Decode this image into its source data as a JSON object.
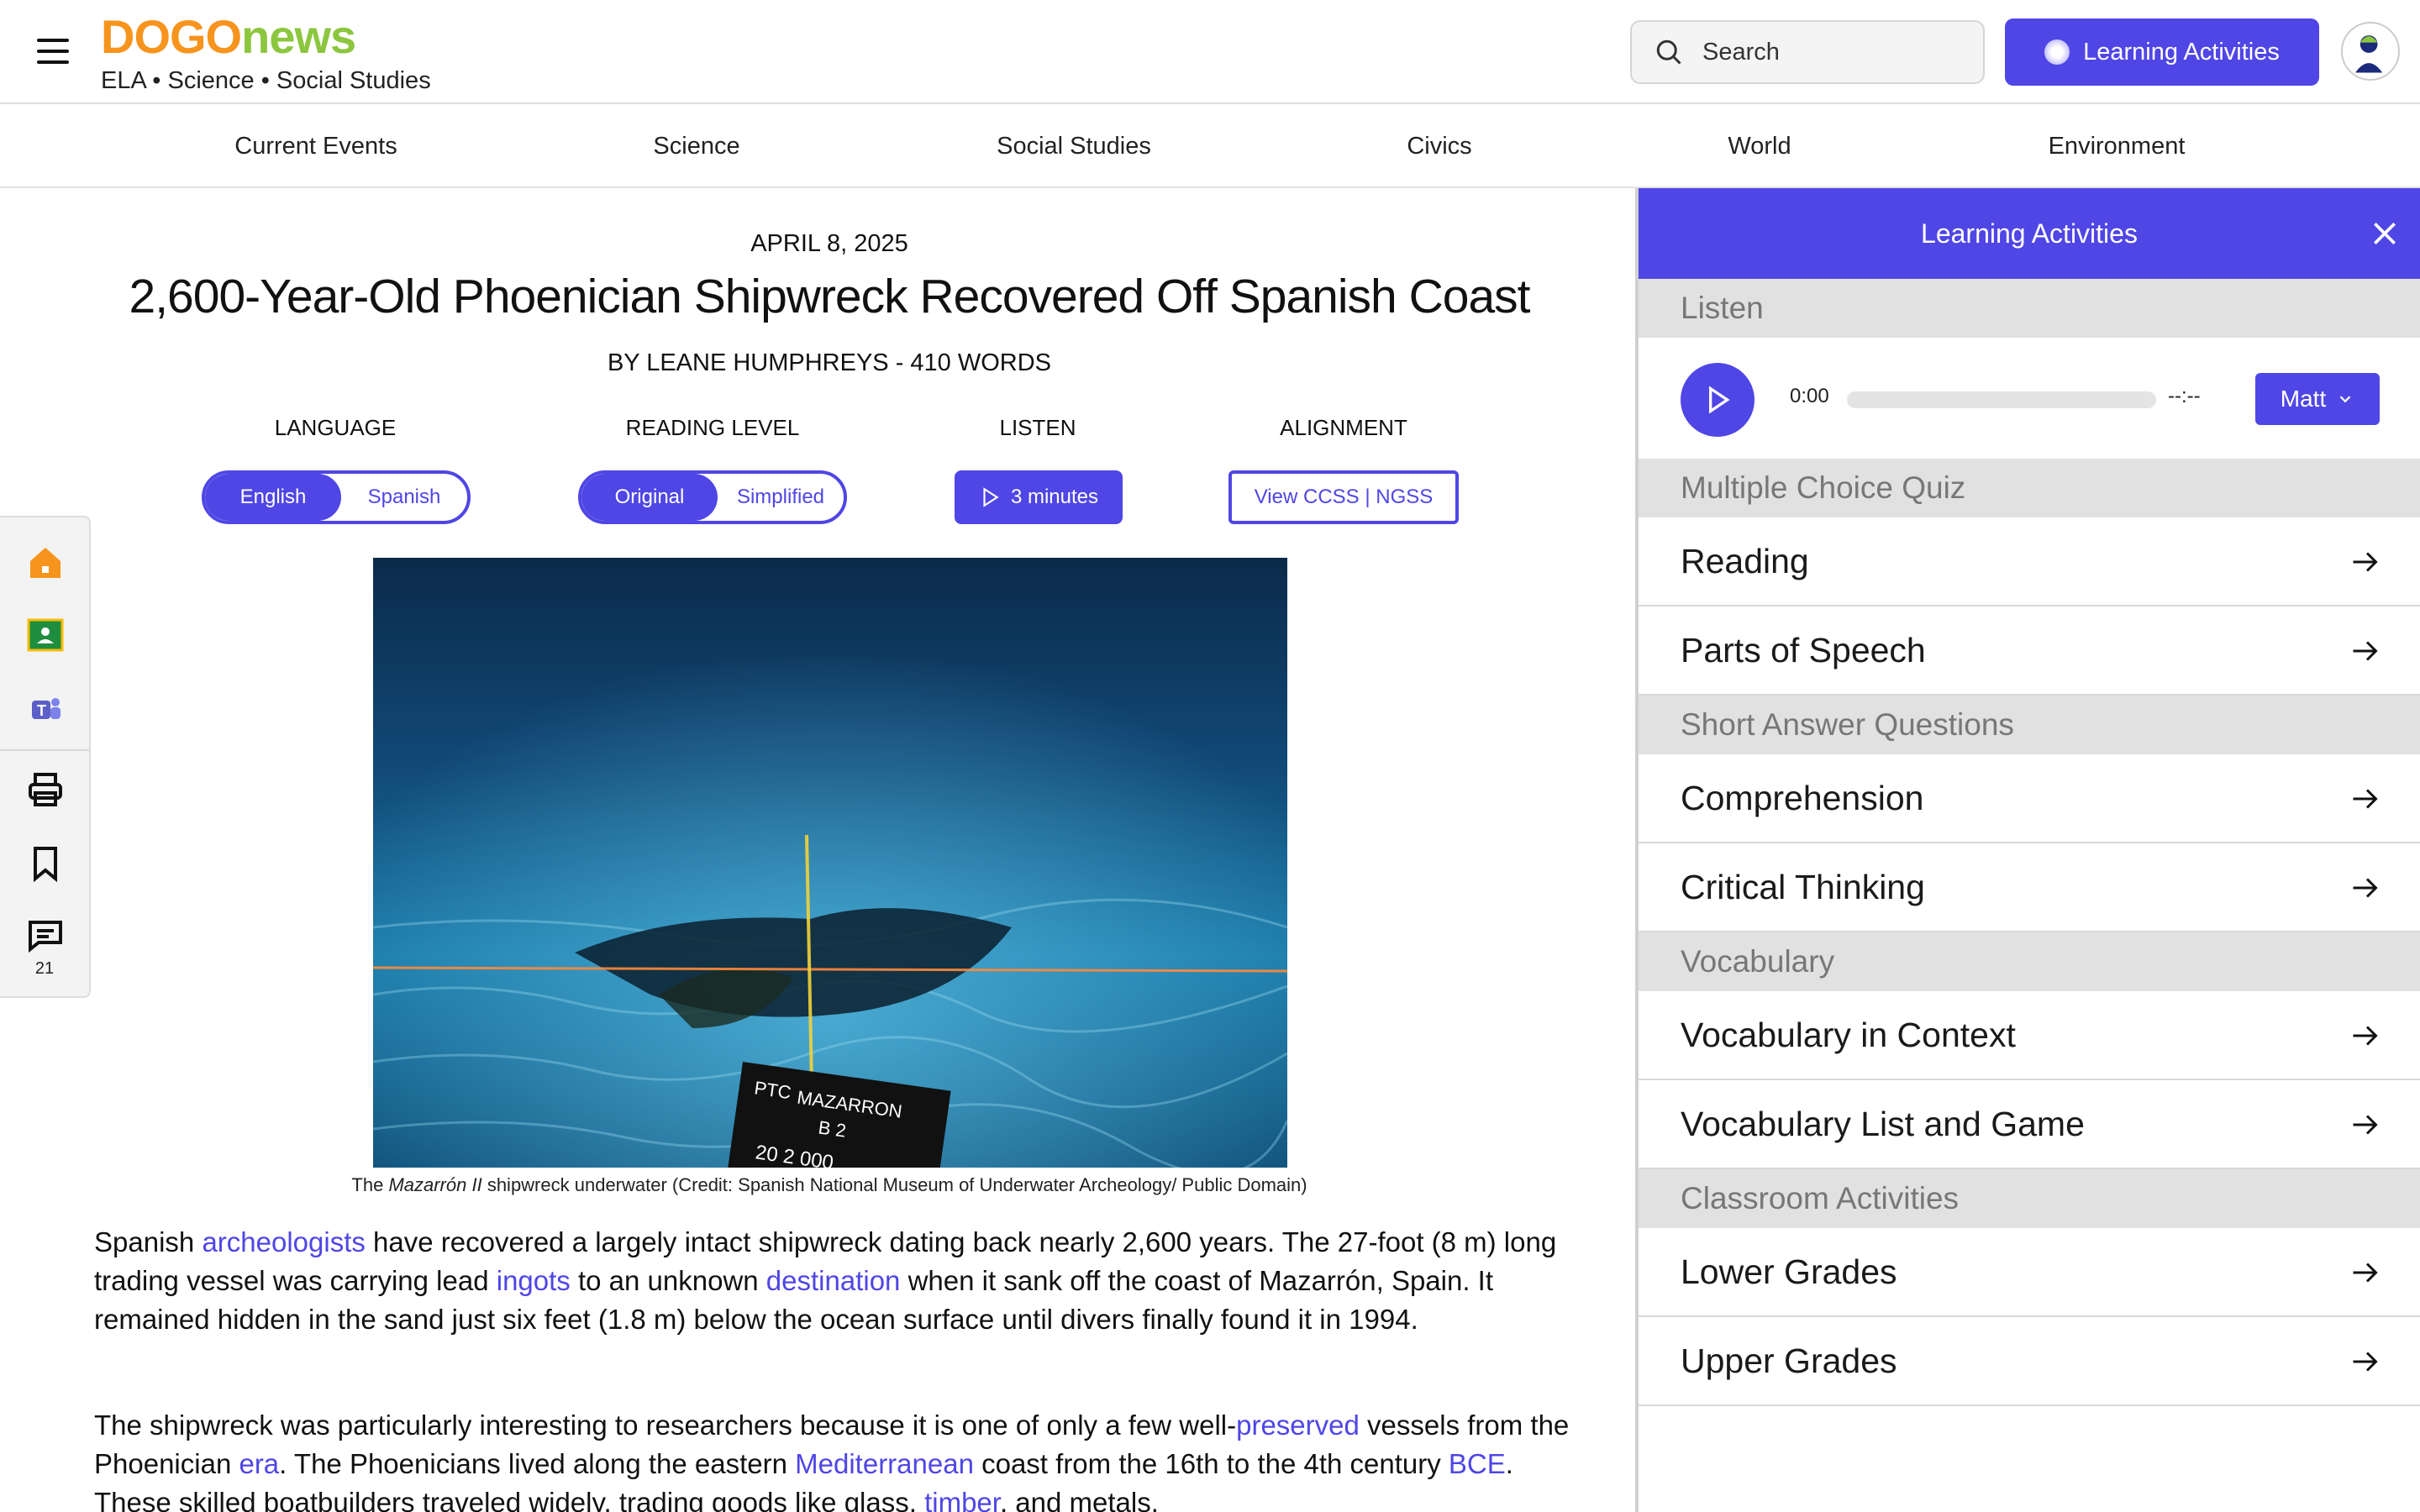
{
  "header": {
    "logo_part1": "DOGO",
    "logo_part2": "news",
    "tagline": "ELA • Science • Social Studies",
    "search_label": "Search",
    "learning_activities_label": "Learning Activities"
  },
  "topnav": [
    "Current Events",
    "Science",
    "Social Studies",
    "Civics",
    "World",
    "Environment"
  ],
  "tools": {
    "comment_count": "21"
  },
  "article": {
    "date": "APRIL 8, 2025",
    "title": "2,600-Year-Old Phoenician Shipwreck Recovered Off Spanish Coast",
    "byline": "BY LEANE HUMPHREYS - 410 WORDS",
    "controls": {
      "language_label": "LANGUAGE",
      "reading_level_label": "READING LEVEL",
      "listen_label": "LISTEN",
      "alignment_label": "ALIGNMENT",
      "language_options": [
        "English",
        "Spanish"
      ],
      "reading_options": [
        "Original",
        "Simplified"
      ],
      "listen_button": "3 minutes",
      "alignment_button": "View CCSS | NGSS"
    },
    "photo_text": {
      "line1": "PTC",
      "line2": "MAZARRON",
      "line3": "B 2",
      "line4": "20  2  000"
    },
    "caption": {
      "prefix": "The ",
      "italic": "Mazarrón II",
      "suffix": " shipwreck underwater (Credit: Spanish National Museum of Underwater Archeology/ Public Domain)"
    },
    "para1": {
      "t1": "Spanish ",
      "l1": "archeologists",
      "t2": " have recovered a largely intact shipwreck dating back nearly 2,600 years. The 27-foot (8 m) long trading vessel was carrying lead ",
      "l2": "ingots",
      "t3": " to an unknown ",
      "l3": "destination",
      "t4": " when it sank off the coast of Mazarrón, Spain. It remained hidden in the sand just six feet (1.8 m) below the ocean surface until divers finally found it in 1994."
    },
    "para2": {
      "t1": "The shipwreck was particularly interesting to researchers because it is one of only a few well-",
      "l1": "preserved",
      "t2": " vessels from the Phoenician ",
      "l2": "era",
      "t3": ". The Phoenicians lived along the eastern ",
      "l3": "Mediterranean",
      "t4": " coast from the 16th to the 4th century ",
      "l4": "BCE",
      "t5": ". These skilled boatbuilders traveled widely, trading goods like glass, ",
      "l5": "timber",
      "t6": ", and metals."
    }
  },
  "panel": {
    "title": "Learning Activities",
    "listen": {
      "section": "Listen",
      "time_current": "0:00",
      "time_total": "--:--",
      "voice": "Matt",
      "progress": 0
    },
    "sections": [
      {
        "title": "Multiple Choice Quiz",
        "items": [
          "Reading",
          "Parts of Speech"
        ]
      },
      {
        "title": "Short Answer Questions",
        "items": [
          "Comprehension",
          "Critical Thinking"
        ]
      },
      {
        "title": "Vocabulary",
        "items": [
          "Vocabulary in Context",
          "Vocabulary List and Game"
        ]
      },
      {
        "title": "Classroom Activities",
        "items": [
          "Lower Grades",
          "Upper Grades"
        ]
      }
    ]
  },
  "colors": {
    "accent": "#4f46e5",
    "logo_orange": "#f7941d",
    "logo_green": "#8cc63f",
    "section_bg": "#e1e1e1"
  }
}
